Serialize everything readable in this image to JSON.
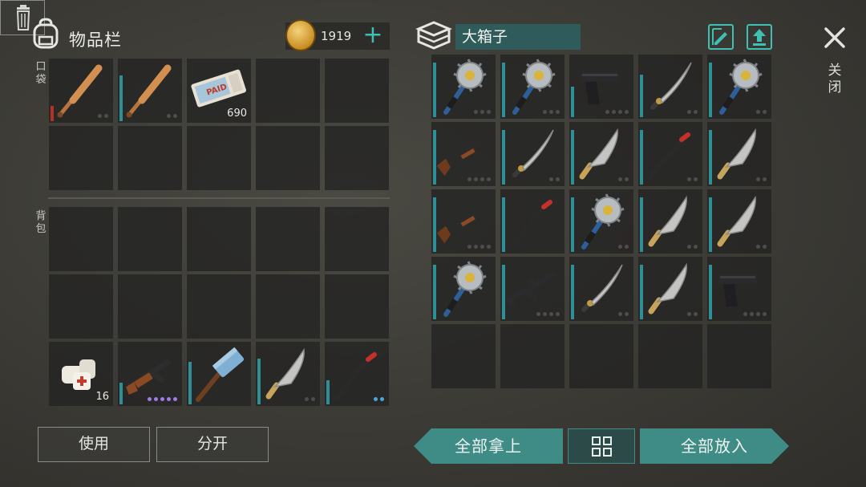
{
  "left_panel": {
    "title": "物品栏",
    "coins": "1919",
    "pocket_label": "口袋",
    "backpack_label": "背包",
    "pocket_slots": [
      {
        "item": "baseball-bat",
        "durability_color": "red",
        "bar": 0.25,
        "dots": [
          "g",
          "g"
        ]
      },
      {
        "item": "baseball-bat",
        "durability_color": "teal",
        "bar": 0.75,
        "dots": [
          "g",
          "g"
        ]
      },
      {
        "item": "paid-ticket",
        "count": "690"
      },
      {},
      {},
      {},
      {},
      {},
      {},
      {}
    ],
    "backpack_slots": [
      {},
      {},
      {},
      {},
      {},
      {},
      {},
      {},
      {},
      {},
      {
        "item": "bandage",
        "count": "16"
      },
      {
        "item": "ak-rifle",
        "bar": 0.35,
        "dots": [
          "p",
          "p",
          "p",
          "p",
          "p"
        ]
      },
      {
        "item": "sledgehammer",
        "bar": 0.7
      },
      {
        "item": "machete",
        "bar": 0.75,
        "dots": [
          "g",
          "g"
        ]
      },
      {
        "item": "crowbar",
        "bar": 0.4,
        "dots": [
          "b",
          "b"
        ]
      }
    ]
  },
  "right_panel": {
    "box_name": "大箱子",
    "slots": [
      {
        "item": "saw-mace",
        "bar": 0.9,
        "dots": [
          "g",
          "g",
          "g"
        ]
      },
      {
        "item": "saw-mace",
        "bar": 0.9,
        "dots": [
          "g",
          "g",
          "g"
        ]
      },
      {
        "item": "pistol",
        "bar": 0.5,
        "dots": [
          "g",
          "g",
          "g",
          "g"
        ]
      },
      {
        "item": "katana",
        "bar": 0.7,
        "dots": [
          "g",
          "g"
        ]
      },
      {
        "item": "saw-mace",
        "bar": 0.9,
        "dots": [
          "g",
          "g"
        ]
      },
      {
        "item": "shotgun",
        "bar": 0.9,
        "dots": [
          "g",
          "g",
          "g",
          "g"
        ]
      },
      {
        "item": "katana",
        "bar": 0.9,
        "dots": [
          "g",
          "g"
        ]
      },
      {
        "item": "machete",
        "bar": 0.9,
        "dots": [
          "g",
          "g"
        ]
      },
      {
        "item": "crowbar",
        "bar": 0.9,
        "dots": [
          "g",
          "g"
        ]
      },
      {
        "item": "machete",
        "bar": 0.9,
        "dots": [
          "g",
          "g"
        ]
      },
      {
        "item": "shotgun",
        "bar": 0.9,
        "dots": [
          "g",
          "g",
          "g",
          "g"
        ]
      },
      {
        "item": "crowbar",
        "bar": 0.9,
        "dots": []
      },
      {
        "item": "saw-mace",
        "bar": 0.9,
        "dots": [
          "g",
          "g"
        ]
      },
      {
        "item": "machete",
        "bar": 0.9,
        "dots": [
          "g",
          "g"
        ]
      },
      {
        "item": "machete",
        "bar": 0.9,
        "dots": [
          "g",
          "g"
        ]
      },
      {
        "item": "saw-mace",
        "bar": 0.9,
        "dots": []
      },
      {
        "item": "m4-rifle",
        "bar": 0.9,
        "dots": [
          "g",
          "g",
          "g",
          "g"
        ]
      },
      {
        "item": "katana",
        "bar": 0.9,
        "dots": [
          "g",
          "g"
        ]
      },
      {
        "item": "machete",
        "bar": 0.9,
        "dots": [
          "g",
          "g"
        ]
      },
      {
        "item": "pistol",
        "bar": 0.9,
        "dots": [
          "g",
          "g",
          "g",
          "g"
        ]
      },
      {},
      {},
      {},
      {},
      {}
    ]
  },
  "buttons": {
    "use": "使用",
    "split": "分开",
    "take_all": "全部拿上",
    "put_all": "全部放入",
    "close": "关闭"
  },
  "colors": {
    "accent": "#3fc0b5",
    "teal_button": "#3f8c86",
    "durability_bar": "#2f8f97"
  }
}
